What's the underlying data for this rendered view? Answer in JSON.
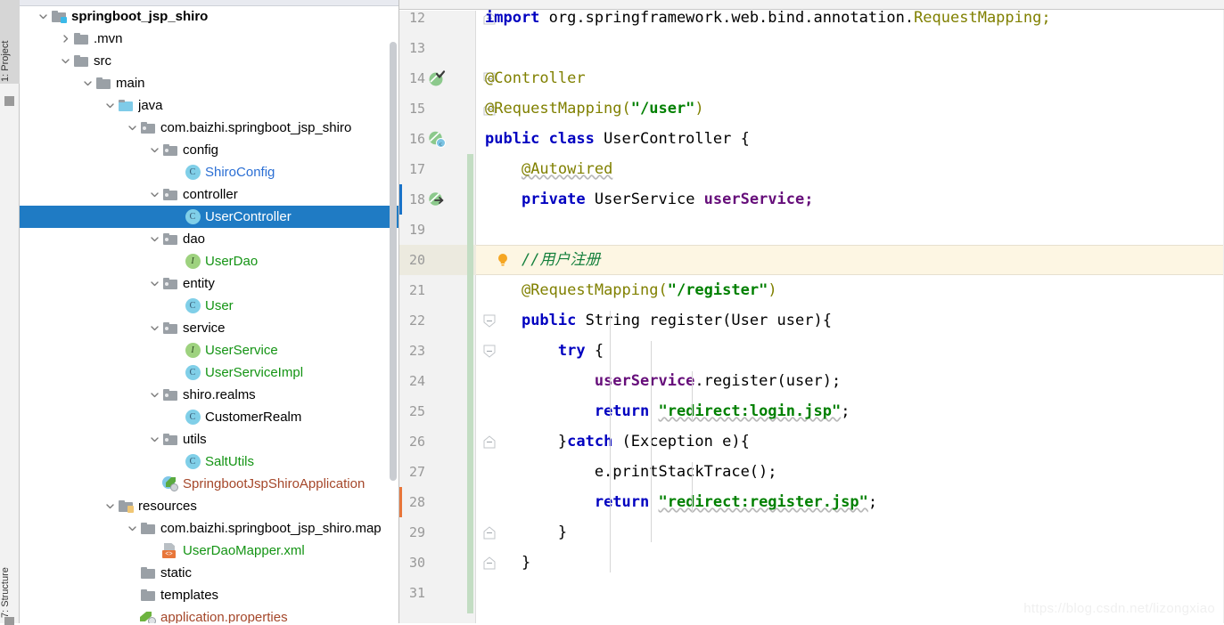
{
  "toolwindows": {
    "top_label": "1: Project",
    "bottom_label": "7: Structure"
  },
  "project_tree": {
    "items": [
      {
        "label": "springboot_jsp_shiro",
        "indent": 0,
        "arrow": "down",
        "icon": "module-folder-icon",
        "color": "c-black",
        "bold": true,
        "selected": false
      },
      {
        "label": ".mvn",
        "indent": 1,
        "arrow": "right",
        "icon": "folder-icon",
        "color": "c-black",
        "bold": false,
        "selected": false
      },
      {
        "label": "src",
        "indent": 1,
        "arrow": "down",
        "icon": "folder-icon",
        "color": "c-black",
        "bold": false,
        "selected": false
      },
      {
        "label": "main",
        "indent": 2,
        "arrow": "down",
        "icon": "folder-icon",
        "color": "c-black",
        "bold": false,
        "selected": false
      },
      {
        "label": "java",
        "indent": 3,
        "arrow": "down",
        "icon": "source-folder-icon",
        "color": "c-black",
        "bold": false,
        "selected": false
      },
      {
        "label": "com.baizhi.springboot_jsp_shiro",
        "indent": 4,
        "arrow": "down",
        "icon": "package-icon",
        "color": "c-black",
        "bold": false,
        "selected": false
      },
      {
        "label": "config",
        "indent": 5,
        "arrow": "down",
        "icon": "package-icon",
        "color": "c-black",
        "bold": false,
        "selected": false
      },
      {
        "label": "ShiroConfig",
        "indent": 6,
        "arrow": "none",
        "icon": "java-class-icon",
        "color": "c-blue",
        "bold": false,
        "selected": false
      },
      {
        "label": "controller",
        "indent": 5,
        "arrow": "down",
        "icon": "package-icon",
        "color": "c-black",
        "bold": false,
        "selected": false
      },
      {
        "label": "UserController",
        "indent": 6,
        "arrow": "none",
        "icon": "java-class-icon",
        "color": "c-black",
        "bold": false,
        "selected": true
      },
      {
        "label": "dao",
        "indent": 5,
        "arrow": "down",
        "icon": "package-icon",
        "color": "c-black",
        "bold": false,
        "selected": false
      },
      {
        "label": "UserDao",
        "indent": 6,
        "arrow": "none",
        "icon": "java-interface-icon",
        "color": "c-green",
        "bold": false,
        "selected": false
      },
      {
        "label": "entity",
        "indent": 5,
        "arrow": "down",
        "icon": "package-icon",
        "color": "c-black",
        "bold": false,
        "selected": false
      },
      {
        "label": "User",
        "indent": 6,
        "arrow": "none",
        "icon": "java-class-icon",
        "color": "c-green",
        "bold": false,
        "selected": false
      },
      {
        "label": "service",
        "indent": 5,
        "arrow": "down",
        "icon": "package-icon",
        "color": "c-black",
        "bold": false,
        "selected": false
      },
      {
        "label": "UserService",
        "indent": 6,
        "arrow": "none",
        "icon": "java-interface-icon",
        "color": "c-green",
        "bold": false,
        "selected": false
      },
      {
        "label": "UserServiceImpl",
        "indent": 6,
        "arrow": "none",
        "icon": "java-class-icon",
        "color": "c-green",
        "bold": false,
        "selected": false
      },
      {
        "label": "shiro.realms",
        "indent": 5,
        "arrow": "down",
        "icon": "package-icon",
        "color": "c-black",
        "bold": false,
        "selected": false
      },
      {
        "label": "CustomerRealm",
        "indent": 6,
        "arrow": "none",
        "icon": "java-class-icon",
        "color": "c-black",
        "bold": false,
        "selected": false
      },
      {
        "label": "utils",
        "indent": 5,
        "arrow": "down",
        "icon": "package-icon",
        "color": "c-black",
        "bold": false,
        "selected": false
      },
      {
        "label": "SaltUtils",
        "indent": 6,
        "arrow": "none",
        "icon": "java-class-icon",
        "color": "c-green",
        "bold": false,
        "selected": false
      },
      {
        "label": "SpringbootJspShiroApplication",
        "indent": 5,
        "arrow": "none",
        "icon": "spring-boot-class-icon",
        "color": "c-brown",
        "bold": false,
        "selected": false
      },
      {
        "label": "resources",
        "indent": 3,
        "arrow": "down",
        "icon": "resources-folder-icon",
        "color": "c-black",
        "bold": false,
        "selected": false
      },
      {
        "label": "com.baizhi.springboot_jsp_shiro.map",
        "indent": 4,
        "arrow": "down",
        "icon": "folder-icon",
        "color": "c-black",
        "bold": false,
        "selected": false
      },
      {
        "label": "UserDaoMapper.xml",
        "indent": 5,
        "arrow": "none",
        "icon": "xml-file-icon",
        "color": "c-green",
        "bold": false,
        "selected": false
      },
      {
        "label": "static",
        "indent": 4,
        "arrow": "none",
        "icon": "folder-icon",
        "color": "c-black",
        "bold": false,
        "selected": false
      },
      {
        "label": "templates",
        "indent": 4,
        "arrow": "none",
        "icon": "folder-icon",
        "color": "c-black",
        "bold": false,
        "selected": false
      },
      {
        "label": "application.properties",
        "indent": 4,
        "arrow": "none",
        "icon": "spring-properties-icon",
        "color": "c-brown",
        "bold": false,
        "selected": false
      }
    ]
  },
  "editor": {
    "watermark": "https://blog.csdn.net/lizongxiao",
    "highlighted_line": 20,
    "lines": [
      {
        "n": 12,
        "gutter_icon": "none",
        "fold": "fold-end",
        "tokens": [
          {
            "t": "import ",
            "c": "kw"
          },
          {
            "t": "org.springframework.web.bind.annotation.",
            "c": "pl"
          },
          {
            "t": "RequestMapping;",
            "c": "ann"
          }
        ]
      },
      {
        "n": 13,
        "gutter_icon": "none",
        "fold": "none",
        "tokens": []
      },
      {
        "n": 14,
        "gutter_icon": "bean-check-icon",
        "fold": "fold-start",
        "tokens": [
          {
            "t": "@Controller",
            "c": "ann"
          }
        ]
      },
      {
        "n": 15,
        "gutter_icon": "none",
        "fold": "fold-end",
        "tokens": [
          {
            "t": "@RequestMapping(",
            "c": "ann"
          },
          {
            "t": "\"/user\"",
            "c": "str"
          },
          {
            "t": ")",
            "c": "ann"
          }
        ]
      },
      {
        "n": 16,
        "gutter_icon": "spring-bean-icon",
        "fold": "none",
        "tokens": [
          {
            "t": "public class ",
            "c": "kw"
          },
          {
            "t": "UserController {",
            "c": "pl"
          }
        ]
      },
      {
        "n": 17,
        "gutter_icon": "none",
        "fold": "none",
        "tokens": [
          {
            "t": "    ",
            "c": "pl"
          },
          {
            "t": "@Autowired",
            "c": "ann wavy"
          }
        ]
      },
      {
        "n": 18,
        "gutter_icon": "autowired-icon",
        "fold": "none",
        "tokens": [
          {
            "t": "    ",
            "c": "pl"
          },
          {
            "t": "private ",
            "c": "kw"
          },
          {
            "t": "UserService ",
            "c": "pl"
          },
          {
            "t": "userService;",
            "c": "fld2"
          }
        ]
      },
      {
        "n": 19,
        "gutter_icon": "none",
        "fold": "none",
        "tokens": []
      },
      {
        "n": 20,
        "gutter_icon": "intention-bulb-icon",
        "fold": "none",
        "tokens": [
          {
            "t": "    ",
            "c": "pl"
          },
          {
            "t": "//用户注册",
            "c": "cmt"
          }
        ]
      },
      {
        "n": 21,
        "gutter_icon": "none",
        "fold": "none",
        "tokens": [
          {
            "t": "    ",
            "c": "pl"
          },
          {
            "t": "@RequestMapping(",
            "c": "ann"
          },
          {
            "t": "\"/register\"",
            "c": "str"
          },
          {
            "t": ")",
            "c": "ann"
          }
        ]
      },
      {
        "n": 22,
        "gutter_icon": "none",
        "fold": "fold-start",
        "tokens": [
          {
            "t": "    ",
            "c": "pl"
          },
          {
            "t": "public ",
            "c": "kw"
          },
          {
            "t": "String register(User user){",
            "c": "pl"
          }
        ]
      },
      {
        "n": 23,
        "gutter_icon": "none",
        "fold": "fold-start",
        "tokens": [
          {
            "t": "        ",
            "c": "pl"
          },
          {
            "t": "try ",
            "c": "kw"
          },
          {
            "t": "{",
            "c": "pl"
          }
        ]
      },
      {
        "n": 24,
        "gutter_icon": "none",
        "fold": "none",
        "tokens": [
          {
            "t": "            ",
            "c": "pl"
          },
          {
            "t": "userService",
            "c": "fld2"
          },
          {
            "t": ".register(user);",
            "c": "pl"
          }
        ]
      },
      {
        "n": 25,
        "gutter_icon": "none",
        "fold": "none",
        "tokens": [
          {
            "t": "            ",
            "c": "pl"
          },
          {
            "t": "return ",
            "c": "kw"
          },
          {
            "t": "\"redirect:login.jsp\"",
            "c": "str wavy"
          },
          {
            "t": ";",
            "c": "pl"
          }
        ]
      },
      {
        "n": 26,
        "gutter_icon": "none",
        "fold": "fold-end",
        "tokens": [
          {
            "t": "        }",
            "c": "pl"
          },
          {
            "t": "catch ",
            "c": "kw"
          },
          {
            "t": "(Exception e){",
            "c": "pl"
          }
        ]
      },
      {
        "n": 27,
        "gutter_icon": "none",
        "fold": "none",
        "tokens": [
          {
            "t": "            e.printStackTrace();",
            "c": "pl"
          }
        ]
      },
      {
        "n": 28,
        "gutter_icon": "none",
        "fold": "none",
        "tokens": [
          {
            "t": "            ",
            "c": "pl"
          },
          {
            "t": "return ",
            "c": "kw"
          },
          {
            "t": "\"redirect:register.jsp\"",
            "c": "str wavy"
          },
          {
            "t": ";",
            "c": "pl"
          }
        ]
      },
      {
        "n": 29,
        "gutter_icon": "none",
        "fold": "fold-end",
        "tokens": [
          {
            "t": "        }",
            "c": "pl"
          }
        ]
      },
      {
        "n": 30,
        "gutter_icon": "none",
        "fold": "fold-end",
        "tokens": [
          {
            "t": "    }",
            "c": "pl"
          }
        ]
      },
      {
        "n": 31,
        "gutter_icon": "none",
        "fold": "none",
        "tokens": []
      }
    ]
  }
}
